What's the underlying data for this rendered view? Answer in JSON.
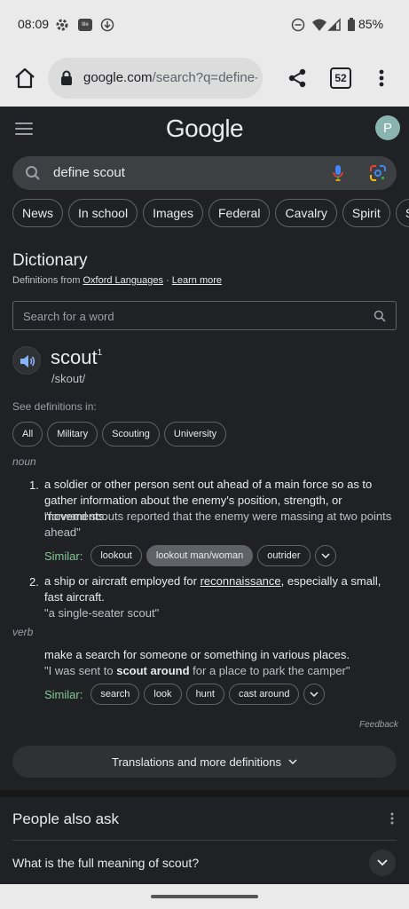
{
  "status_bar": {
    "time": "08:09",
    "app_badge": "tile",
    "battery": "85%",
    "icons": [
      "settings-icon",
      "tile-app-icon",
      "download-icon",
      "dnd-icon",
      "wifi-icon",
      "signal-icon",
      "battery-icon"
    ]
  },
  "browser": {
    "url_host": "google.com",
    "url_path": "/search?q=define-",
    "tab_count": "52"
  },
  "google": {
    "logo": "Google",
    "avatar_initial": "P",
    "query": "define scout",
    "chips": [
      "News",
      "In school",
      "Images",
      "Federal",
      "Cavalry",
      "Spirit",
      "Shop"
    ]
  },
  "dictionary": {
    "title": "Dictionary",
    "source_prefix": "Definitions from ",
    "source_name": "Oxford Languages",
    "source_sep": " · ",
    "learn_more": "Learn more",
    "search_placeholder": "Search for a word",
    "headword": "scout",
    "headword_sup": "1",
    "phonetic": "/skout/",
    "see_defs_label": "See definitions in:",
    "def_chips": [
      "All",
      "Military",
      "Scouting",
      "University"
    ],
    "noun_label": "noun",
    "noun_defs": [
      {
        "num": "1.",
        "text": "a soldier or other person sent out ahead of a main force so as to gather information about the enemy's position, strength, or movements.",
        "example": "\"forward scouts reported that the enemy were massing at two points ahead\"",
        "similar_label": "Similar:",
        "similar": [
          "lookout",
          "lookout man/woman",
          "outrider"
        ]
      },
      {
        "num": "2.",
        "text_before": "a ship or aircraft employed for ",
        "text_link": "reconnaissance",
        "text_after": ", especially a small, fast aircraft.",
        "example": "\"a single-seater scout\""
      }
    ],
    "verb_label": "verb",
    "verb_def": {
      "text": "make a search for someone or something in various places.",
      "example_before": "\"I was sent to ",
      "example_bold": "scout around",
      "example_after": " for a place to park the camper\"",
      "similar_label": "Similar:",
      "similar": [
        "search",
        "look",
        "hunt",
        "cast around"
      ]
    },
    "feedback": "Feedback",
    "translations_button": "Translations and more definitions"
  },
  "people_also_ask": {
    "title": "People also ask",
    "questions": [
      "What is the full meaning of scout?"
    ]
  },
  "colors": {
    "background": "#202124",
    "similar_green": "#81c995",
    "mic_blue": "#4285f4"
  }
}
